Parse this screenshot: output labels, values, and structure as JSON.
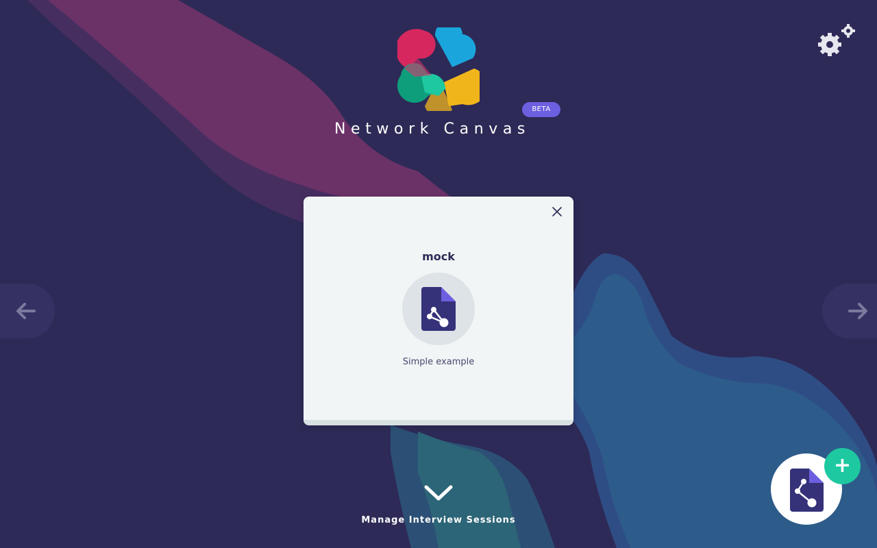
{
  "app": {
    "title": "Network Canvas",
    "badge": "BETA"
  },
  "colors": {
    "background": "#2d2a57",
    "magenta_wave": "#6b3268",
    "blue_wave": "#2d5b8a",
    "card_bg": "#f1f5f5",
    "accent_purple": "#6c5fe0",
    "accent_green": "#1ec8a0",
    "text_dark": "#2d2a57"
  },
  "icons": {
    "settings": "gears-icon",
    "prev": "arrow-left-icon",
    "next": "arrow-right-icon",
    "close": "close-icon",
    "protocol": "protocol-file-icon",
    "manage": "chevron-down-icon",
    "add": "plus-icon"
  },
  "protocol_card": {
    "name": "mock",
    "description": "Simple example"
  },
  "sessions": {
    "label": "Manage Interview Sessions"
  },
  "fab": {
    "plus": "+"
  }
}
